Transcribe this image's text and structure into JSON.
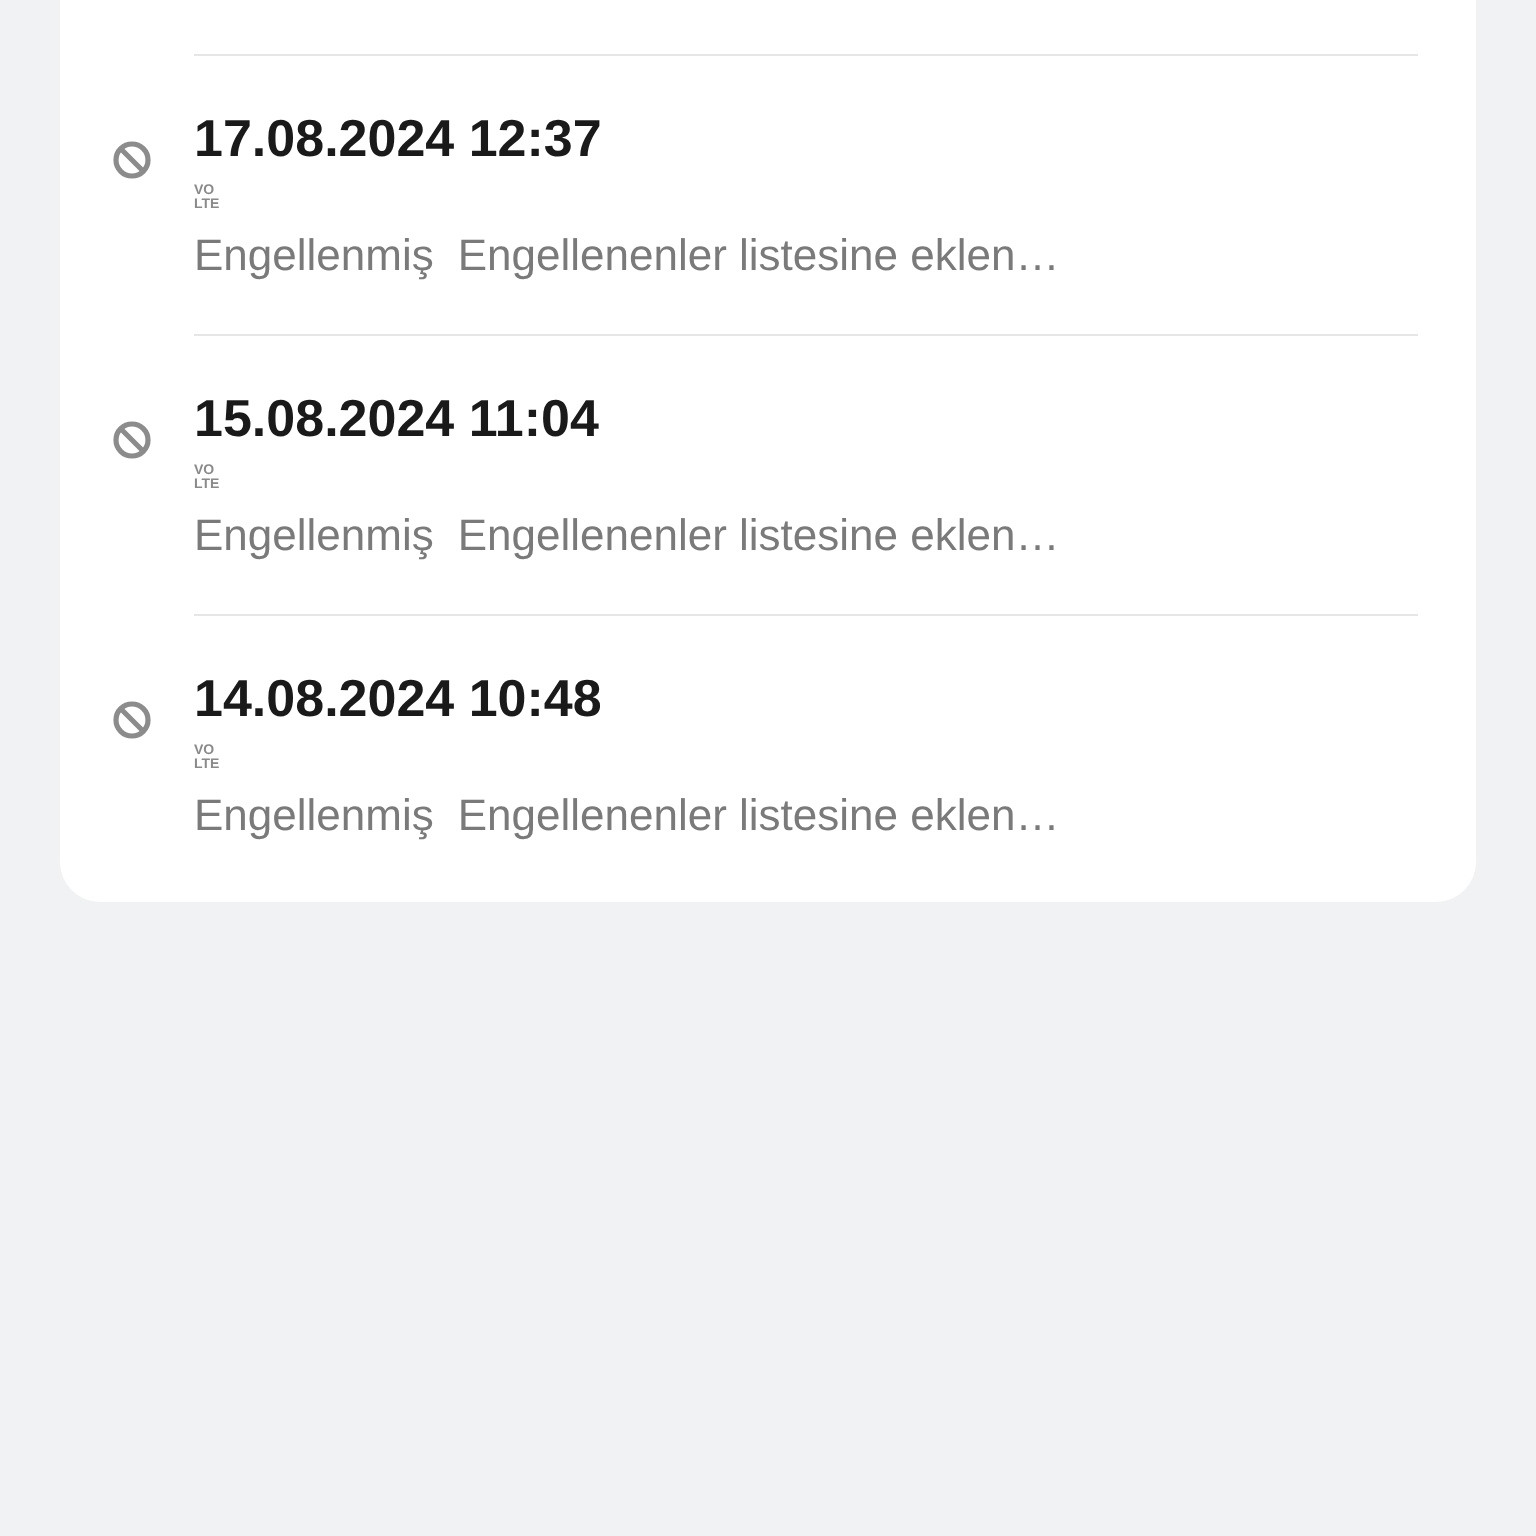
{
  "calls": [
    {
      "date": "17.08.2024 12:37",
      "network": {
        "top": "VO",
        "bottom": "LTE"
      },
      "status": "Engellenmiş",
      "note": "Engellenenler listesine eklen…"
    },
    {
      "date": "15.08.2024 11:04",
      "network": {
        "top": "VO",
        "bottom": "LTE"
      },
      "status": "Engellenmiş",
      "note": "Engellenenler listesine eklen…"
    },
    {
      "date": "14.08.2024 10:48",
      "network": {
        "top": "VO",
        "bottom": "LTE"
      },
      "status": "Engellenmiş",
      "note": "Engellenenler listesine eklen…"
    }
  ]
}
